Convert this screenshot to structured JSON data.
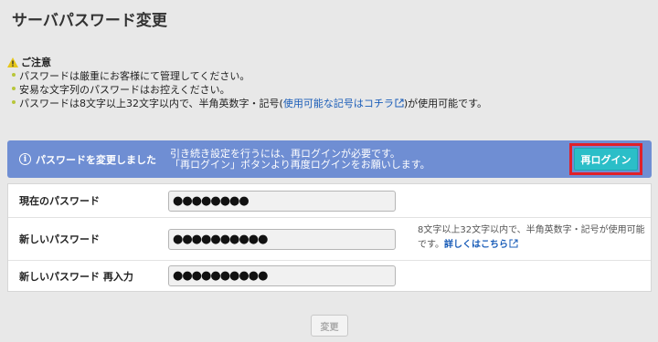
{
  "page": {
    "title": "サーバパスワード変更"
  },
  "notice": {
    "heading": "ご注意",
    "items": [
      "パスワードは厳重にお客様にて管理してください。",
      "安易な文字列のパスワードはお控えください。"
    ],
    "item3_prefix": "パスワードは8文字以上32文字以内で、半角英数字・記号(",
    "item3_link": "使用可能な記号はコチラ",
    "item3_suffix": ")が使用可能です。"
  },
  "alert": {
    "title": "パスワードを変更しました",
    "message_line1": "引き続き設定を行うには、再ログインが必要です。",
    "message_line2": "「再ログイン」ボタンより再度ログインをお願いします。",
    "relogin_label": "再ログイン",
    "bg_color": "#6f8ed3",
    "button_color": "#2bbec8",
    "highlight_color": "#e0202a"
  },
  "form": {
    "rows": [
      {
        "label": "現在のパスワード",
        "value": "●●●●●●●●"
      },
      {
        "label": "新しいパスワード",
        "value": "●●●●●●●●●●"
      },
      {
        "label": "新しいパスワード 再入力",
        "value": "●●●●●●●●●●"
      }
    ],
    "hint_text": "8文字以上32文字以内で、半角英数字・記号が使用可能です。",
    "hint_link": "詳しくはこちら"
  },
  "actions": {
    "change_label": "変更"
  },
  "icons": {
    "warning": "warning-icon",
    "info": "info-icon",
    "external": "external-link-icon"
  }
}
